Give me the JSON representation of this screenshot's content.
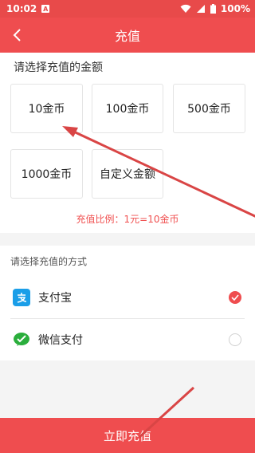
{
  "status_bar": {
    "time": "10:02",
    "notification_badge": "A",
    "battery": "100%"
  },
  "header": {
    "title": "充值",
    "back_icon": "chevron-left-icon"
  },
  "amount_section": {
    "label": "请选择充值的金额",
    "options": [
      "10金币",
      "100金币",
      "500金币",
      "1000金币",
      "自定义金额"
    ],
    "ratio": "充值比例：1元=10金币"
  },
  "payment_section": {
    "label": "请选择充值的方式",
    "methods": [
      {
        "name": "支付宝",
        "icon": "alipay-icon",
        "selected": true
      },
      {
        "name": "微信支付",
        "icon": "wechat-pay-icon",
        "selected": false
      }
    ]
  },
  "confirm_button": "立即充值",
  "colors": {
    "primary_red": "#ef4d4f",
    "alipay_blue": "#1a9ee8",
    "wechat_green": "#2aae3c"
  }
}
